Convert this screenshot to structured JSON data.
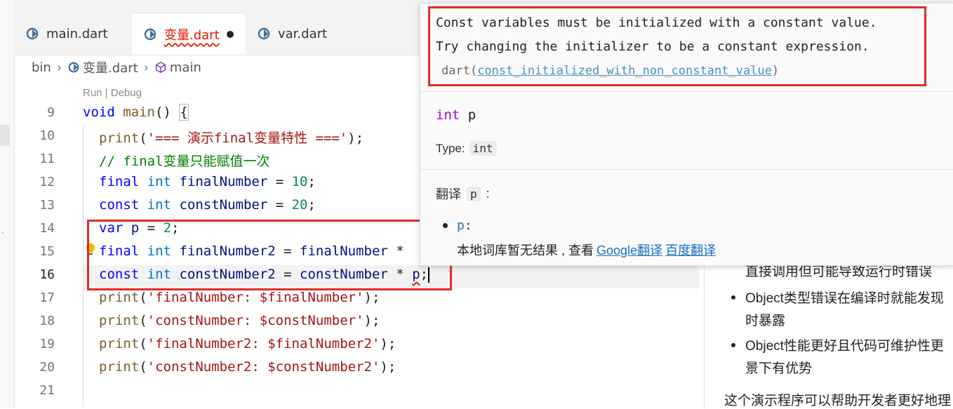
{
  "tabs": [
    {
      "label": "main.dart"
    },
    {
      "label": "变量.dart"
    },
    {
      "label": "var.dart"
    }
  ],
  "breadcrumb": {
    "root": "bin",
    "file": "变量.dart",
    "symbol": "main"
  },
  "codelens": "Run | Debug",
  "lines": [
    {
      "num": "9"
    },
    {
      "num": "10"
    },
    {
      "num": "11"
    },
    {
      "num": "12"
    },
    {
      "num": "13"
    },
    {
      "num": "14"
    },
    {
      "num": "15"
    },
    {
      "num": "16"
    },
    {
      "num": "17"
    },
    {
      "num": "18"
    },
    {
      "num": "19"
    },
    {
      "num": "20"
    },
    {
      "num": "21"
    }
  ],
  "code": {
    "l9": {
      "kw": "void",
      "fn": "main",
      "rest": "() ",
      "brace": "{"
    },
    "l10": {
      "fn": "print",
      "str": "'=== 演示final变量特性 ==='",
      "end": ");"
    },
    "l11": {
      "comment": "// final变量只能赋值一次"
    },
    "l12": {
      "kw": "final",
      "ty": "int",
      "name": "finalNumber",
      "eq": " = ",
      "num": "10",
      "end": ";"
    },
    "l13": {
      "kw": "const",
      "ty": "int",
      "name": "constNumber",
      "eq": " = ",
      "num": "20",
      "end": ";"
    },
    "l14": {
      "kw": "var",
      "name": "p",
      "eq": " = ",
      "num": "2",
      "end": ";"
    },
    "l15": {
      "kw": "final",
      "ty": "int",
      "name": "finalNumber2",
      "eq": " = ",
      "ref": "finalNumber",
      "op": " *"
    },
    "l16": {
      "kw": "const",
      "ty": "int",
      "name": "constNumber2",
      "eq": " = ",
      "ref": "constNumber",
      "op": " * ",
      "p": "p",
      "end": ";"
    },
    "l17": {
      "fn": "print",
      "str": "'finalNumber: $finalNumber'",
      "end": ");"
    },
    "l18": {
      "fn": "print",
      "str": "'constNumber: $constNumber'",
      "end": ");"
    },
    "l19": {
      "fn": "print",
      "str": "'finalNumber2: $finalNumber2'",
      "end": ");"
    },
    "l20": {
      "fn": "print",
      "str": "'constNumber2: $constNumber2'",
      "end": ");"
    }
  },
  "hover": {
    "diag_line1": "Const variables must be initialized with a constant value.",
    "diag_line2": "Try changing the initializer to be a constant expression.",
    "code_prefix": "dart(",
    "code_link": "const_initialized_with_non_constant_value",
    "code_suffix": ")",
    "sig_type": "int",
    "sig_name": " p",
    "type_label": "Type:",
    "type_value": "int",
    "translate_label": "翻译",
    "translate_term": "p",
    "translate_colon": ":",
    "result_word": "p",
    "result_colon": ":",
    "result_text": "本地词库暂无结果 , 查看",
    "google_link": "Google翻译",
    "baidu_link": "百度翻译"
  },
  "right_panel": {
    "line_partial": "直接调用但可能导致运行时错误",
    "bullet1_line1": "Object类型错误在编译时就能发现",
    "bullet1_line2": "时暴露",
    "bullet2_line1": "Object性能更好且代码可维护性更",
    "bullet2_line2": "景下有优势",
    "footer": "这个演示程序可以帮助开发者更好地理"
  },
  "colors": {
    "error": "#e51400",
    "highlight_box": "#e32b2b",
    "link": "#1a6fc4"
  }
}
